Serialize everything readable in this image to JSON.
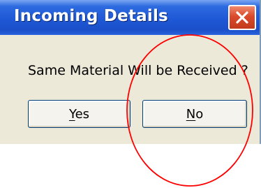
{
  "dialog": {
    "title": "Incoming Details",
    "close_icon": "close-icon",
    "message": "Same Material Will be Received ?",
    "buttons": [
      {
        "label": "Yes",
        "mnemonic": "Y",
        "rest": "es"
      },
      {
        "label": "No",
        "mnemonic": "N",
        "rest": "o"
      }
    ]
  },
  "annotation": {
    "shape": "circle",
    "color": "#ff0000",
    "target": "No button"
  },
  "colors": {
    "titlebar": "#1f58d6",
    "dialog_background": "#ece9d8",
    "close_button": "#d94a2a",
    "annotation": "#ff0000"
  }
}
